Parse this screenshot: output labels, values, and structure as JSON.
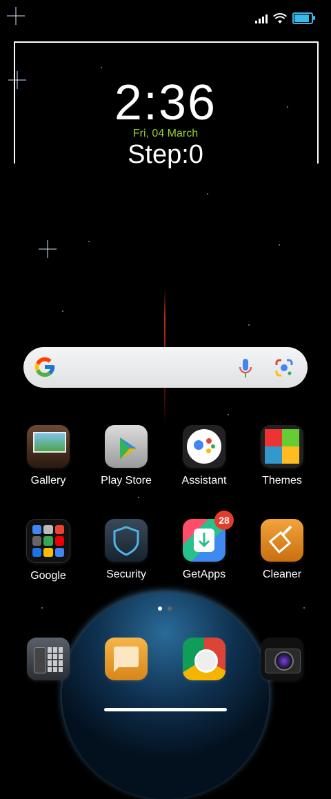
{
  "status_bar": {
    "icons": [
      "signal-icon",
      "wifi-icon",
      "battery-icon"
    ],
    "battery_level": 0.9
  },
  "clock_widget": {
    "time": "2:36",
    "date": "Fri, 04 March",
    "steps": "Step:0"
  },
  "search_bar": {
    "logo": "google-icon",
    "mic": "mic-icon",
    "lens": "lens-icon"
  },
  "apps_row1": [
    {
      "label": "Gallery",
      "icon": "gallery-icon"
    },
    {
      "label": "Play Store",
      "icon": "play-store-icon"
    },
    {
      "label": "Assistant",
      "icon": "assistant-icon"
    },
    {
      "label": "Themes",
      "icon": "themes-icon"
    }
  ],
  "apps_row2": [
    {
      "label": "Google",
      "icon": "google-folder-icon"
    },
    {
      "label": "Security",
      "icon": "security-icon"
    },
    {
      "label": "GetApps",
      "icon": "getapps-icon",
      "badge": "28"
    },
    {
      "label": "Cleaner",
      "icon": "cleaner-icon"
    }
  ],
  "dock": [
    {
      "icon": "phone-icon"
    },
    {
      "icon": "messages-icon"
    },
    {
      "icon": "chrome-icon"
    },
    {
      "icon": "camera-icon"
    }
  ],
  "page_indicator": {
    "pages": 2,
    "current": 1
  },
  "colors": {
    "date": "#9ad22a",
    "badge": "#e43c2c",
    "battery": "#3bb7e8"
  }
}
